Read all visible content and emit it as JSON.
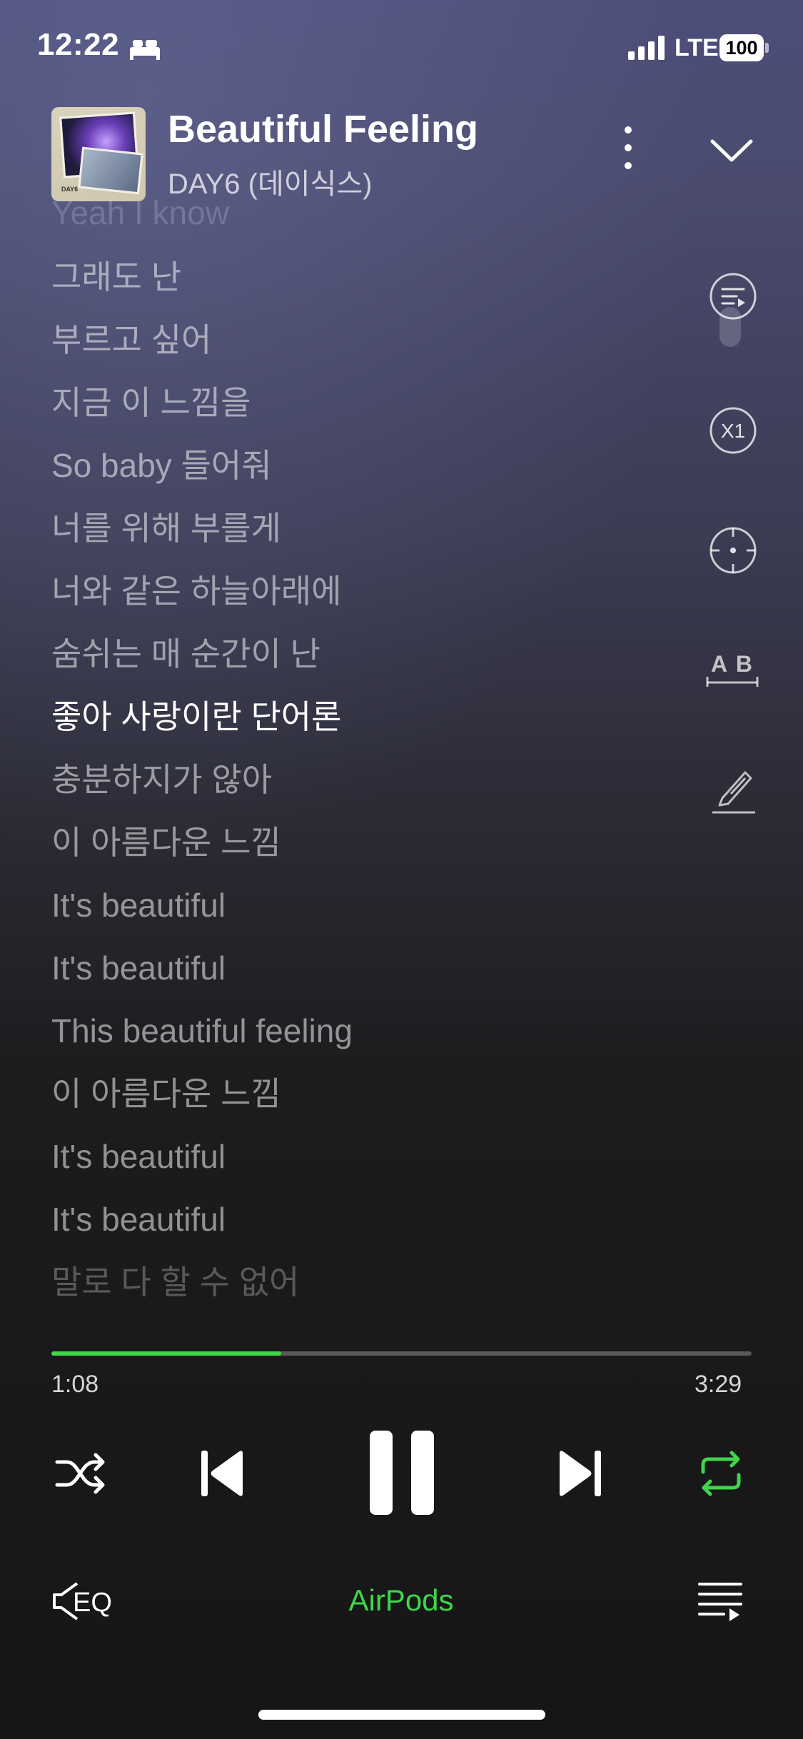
{
  "status_bar": {
    "time": "12:22",
    "network": "LTE",
    "battery": "100",
    "icons": [
      "bed-icon",
      "signal-icon",
      "battery-icon"
    ]
  },
  "now_playing": {
    "title": "Beautiful Feeling",
    "artist": "DAY6 (데이식스)",
    "album_art_text": "DAY6"
  },
  "lyrics": {
    "lines": [
      "Yeah I know",
      "그래도 난",
      "부르고 싶어",
      "지금 이 느낌을",
      "So baby 들어줘",
      "너를 위해 부를게",
      "너와 같은 하늘아래에",
      "숨쉬는 매 순간이 난",
      "좋아 사랑이란 단어론",
      "충분하지가 않아",
      "이 아름다운 느낌",
      "It's beautiful",
      "It's beautiful",
      "This beautiful feeling",
      "이 아름다운 느낌",
      "It's beautiful",
      "It's beautiful",
      "말로 다 할 수 없어"
    ],
    "active_index": 8
  },
  "side_tools": {
    "speed_label": "X1",
    "translate_label": "A B",
    "icons": [
      "lyrics-list-icon",
      "speed-icon",
      "locate-icon",
      "translate-icon",
      "highlight-pen-icon"
    ]
  },
  "playback": {
    "elapsed": "1:08",
    "total": "3:29",
    "progress_fraction": 0.328
  },
  "controls": {
    "icons": [
      "shuffle-icon",
      "previous-icon",
      "pause-icon",
      "next-icon",
      "repeat-icon"
    ],
    "repeat_active": true
  },
  "bottom_bar": {
    "eq_label": "EQ",
    "output_device": "AirPods",
    "icons": [
      "eq-icon",
      "queue-icon"
    ]
  },
  "colors": {
    "accent": "#3ed64a",
    "background_top": "#4c4e79",
    "background_bottom": "#161616"
  }
}
